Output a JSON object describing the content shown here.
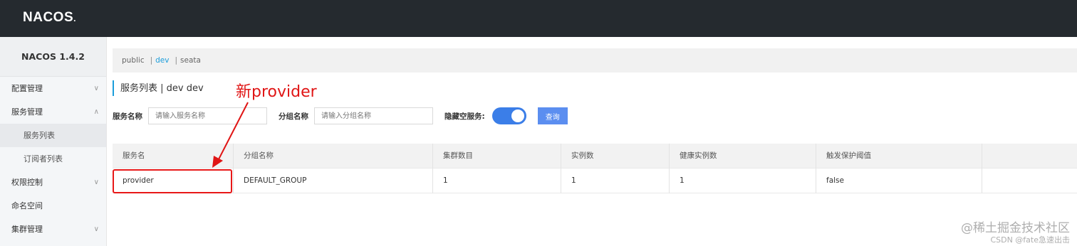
{
  "app": {
    "logo": "NACOS",
    "logo_dot": "."
  },
  "sidebar": {
    "version": "NACOS 1.4.2",
    "items": [
      {
        "label": "配置管理",
        "chev": "∨"
      },
      {
        "label": "服务管理",
        "chev": "∧"
      },
      {
        "label": "服务列表"
      },
      {
        "label": "订阅者列表"
      },
      {
        "label": "权限控制",
        "chev": "∨"
      },
      {
        "label": "命名空间"
      },
      {
        "label": "集群管理",
        "chev": "∨"
      }
    ]
  },
  "namespaces": {
    "items": [
      "public",
      "dev",
      "seata"
    ],
    "separator": "|",
    "active": "dev"
  },
  "page": {
    "title": "服务列表 | dev dev"
  },
  "filters": {
    "service_name_label": "服务名称",
    "service_name_placeholder": "请输入服务名称",
    "group_name_label": "分组名称",
    "group_name_placeholder": "请输入分组名称",
    "hide_empty_label": "隐藏空服务:",
    "query_label": "查询"
  },
  "table": {
    "headers": [
      "服务名",
      "分组名称",
      "集群数目",
      "实例数",
      "健康实例数",
      "触发保护阈值",
      ""
    ],
    "rows": [
      [
        "provider",
        "DEFAULT_GROUP",
        "1",
        "1",
        "1",
        "false",
        ""
      ]
    ]
  },
  "annotation": {
    "text": "新provider",
    "color": "#e01515"
  },
  "watermark": {
    "line1": "@稀土掘金技术社区",
    "line2": "CSDN @fate急速出击"
  },
  "colors": {
    "topbar": "#252a2f",
    "accent": "#1a9ddb",
    "toggle": "#3b7ee8",
    "button": "#5b8ef0"
  }
}
